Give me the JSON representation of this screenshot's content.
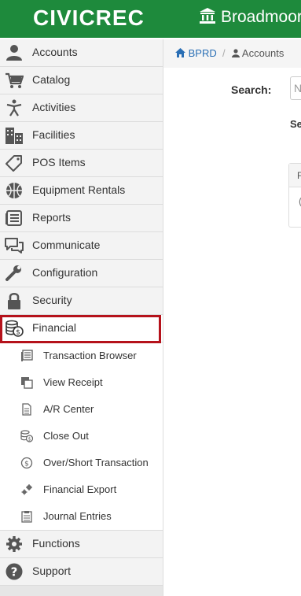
{
  "header": {
    "brand": "CIVICREC",
    "org_name": "Broadmoor"
  },
  "sidebar": {
    "items": [
      {
        "label": "Accounts",
        "icon": "user-icon"
      },
      {
        "label": "Catalog",
        "icon": "cart-icon"
      },
      {
        "label": "Activities",
        "icon": "activity-person-icon"
      },
      {
        "label": "Facilities",
        "icon": "building-icon"
      },
      {
        "label": "POS Items",
        "icon": "tag-icon"
      },
      {
        "label": "Equipment Rentals",
        "icon": "basketball-icon"
      },
      {
        "label": "Reports",
        "icon": "reports-icon"
      },
      {
        "label": "Communicate",
        "icon": "chat-icon"
      },
      {
        "label": "Configuration",
        "icon": "wrench-icon"
      },
      {
        "label": "Security",
        "icon": "lock-icon"
      },
      {
        "label": "Financial",
        "icon": "coins-icon"
      }
    ],
    "financial_subitems": [
      {
        "label": "Transaction Browser",
        "icon": "transactions-icon"
      },
      {
        "label": "View Receipt",
        "icon": "receipt-copy-icon"
      },
      {
        "label": "A/R Center",
        "icon": "document-icon"
      },
      {
        "label": "Close Out",
        "icon": "coins-small-icon"
      },
      {
        "label": "Over/Short Transaction",
        "icon": "dollar-circle-icon"
      },
      {
        "label": "Financial Export",
        "icon": "gears-icon"
      },
      {
        "label": "Journal Entries",
        "icon": "clipboard-icon"
      }
    ],
    "bottom_items": [
      {
        "label": "Functions",
        "icon": "gear-icon"
      },
      {
        "label": "Support",
        "icon": "question-icon"
      }
    ],
    "selected": "Financial"
  },
  "breadcrumb": {
    "home": "BPRD",
    "separator": "/",
    "current": "Accounts"
  },
  "main": {
    "search_label": "Search:",
    "search_placeholder": "N",
    "select_label": "Se",
    "panel_head": "F",
    "panel_body": "("
  },
  "colors": {
    "brand_green": "#1e8a3c",
    "highlight_red": "#b5121b",
    "link_blue": "#2a6fb5"
  }
}
